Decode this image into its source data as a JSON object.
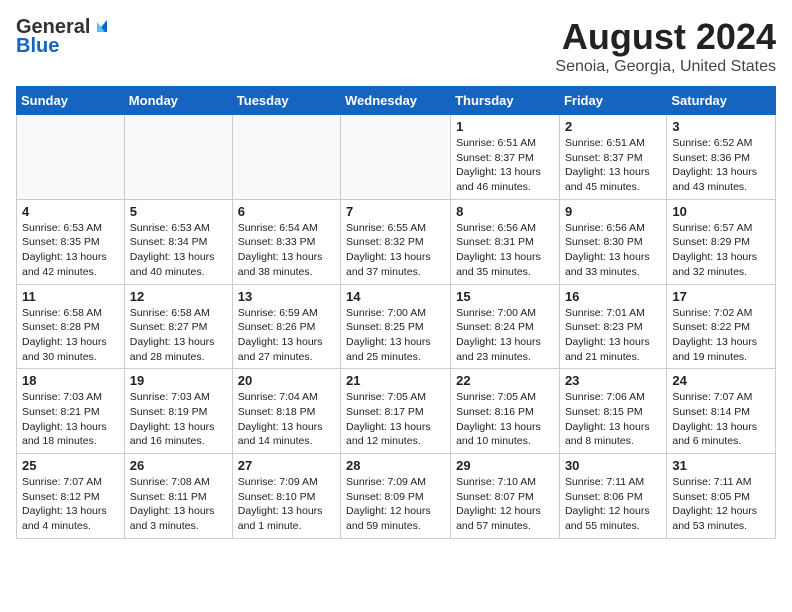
{
  "header": {
    "logo_general": "General",
    "logo_blue": "Blue",
    "title": "August 2024",
    "subtitle": "Senoia, Georgia, United States"
  },
  "days_of_week": [
    "Sunday",
    "Monday",
    "Tuesday",
    "Wednesday",
    "Thursday",
    "Friday",
    "Saturday"
  ],
  "weeks": [
    [
      {
        "day": "",
        "content": ""
      },
      {
        "day": "",
        "content": ""
      },
      {
        "day": "",
        "content": ""
      },
      {
        "day": "",
        "content": ""
      },
      {
        "day": "1",
        "content": "Sunrise: 6:51 AM\nSunset: 8:37 PM\nDaylight: 13 hours\nand 46 minutes."
      },
      {
        "day": "2",
        "content": "Sunrise: 6:51 AM\nSunset: 8:37 PM\nDaylight: 13 hours\nand 45 minutes."
      },
      {
        "day": "3",
        "content": "Sunrise: 6:52 AM\nSunset: 8:36 PM\nDaylight: 13 hours\nand 43 minutes."
      }
    ],
    [
      {
        "day": "4",
        "content": "Sunrise: 6:53 AM\nSunset: 8:35 PM\nDaylight: 13 hours\nand 42 minutes."
      },
      {
        "day": "5",
        "content": "Sunrise: 6:53 AM\nSunset: 8:34 PM\nDaylight: 13 hours\nand 40 minutes."
      },
      {
        "day": "6",
        "content": "Sunrise: 6:54 AM\nSunset: 8:33 PM\nDaylight: 13 hours\nand 38 minutes."
      },
      {
        "day": "7",
        "content": "Sunrise: 6:55 AM\nSunset: 8:32 PM\nDaylight: 13 hours\nand 37 minutes."
      },
      {
        "day": "8",
        "content": "Sunrise: 6:56 AM\nSunset: 8:31 PM\nDaylight: 13 hours\nand 35 minutes."
      },
      {
        "day": "9",
        "content": "Sunrise: 6:56 AM\nSunset: 8:30 PM\nDaylight: 13 hours\nand 33 minutes."
      },
      {
        "day": "10",
        "content": "Sunrise: 6:57 AM\nSunset: 8:29 PM\nDaylight: 13 hours\nand 32 minutes."
      }
    ],
    [
      {
        "day": "11",
        "content": "Sunrise: 6:58 AM\nSunset: 8:28 PM\nDaylight: 13 hours\nand 30 minutes."
      },
      {
        "day": "12",
        "content": "Sunrise: 6:58 AM\nSunset: 8:27 PM\nDaylight: 13 hours\nand 28 minutes."
      },
      {
        "day": "13",
        "content": "Sunrise: 6:59 AM\nSunset: 8:26 PM\nDaylight: 13 hours\nand 27 minutes."
      },
      {
        "day": "14",
        "content": "Sunrise: 7:00 AM\nSunset: 8:25 PM\nDaylight: 13 hours\nand 25 minutes."
      },
      {
        "day": "15",
        "content": "Sunrise: 7:00 AM\nSunset: 8:24 PM\nDaylight: 13 hours\nand 23 minutes."
      },
      {
        "day": "16",
        "content": "Sunrise: 7:01 AM\nSunset: 8:23 PM\nDaylight: 13 hours\nand 21 minutes."
      },
      {
        "day": "17",
        "content": "Sunrise: 7:02 AM\nSunset: 8:22 PM\nDaylight: 13 hours\nand 19 minutes."
      }
    ],
    [
      {
        "day": "18",
        "content": "Sunrise: 7:03 AM\nSunset: 8:21 PM\nDaylight: 13 hours\nand 18 minutes."
      },
      {
        "day": "19",
        "content": "Sunrise: 7:03 AM\nSunset: 8:19 PM\nDaylight: 13 hours\nand 16 minutes."
      },
      {
        "day": "20",
        "content": "Sunrise: 7:04 AM\nSunset: 8:18 PM\nDaylight: 13 hours\nand 14 minutes."
      },
      {
        "day": "21",
        "content": "Sunrise: 7:05 AM\nSunset: 8:17 PM\nDaylight: 13 hours\nand 12 minutes."
      },
      {
        "day": "22",
        "content": "Sunrise: 7:05 AM\nSunset: 8:16 PM\nDaylight: 13 hours\nand 10 minutes."
      },
      {
        "day": "23",
        "content": "Sunrise: 7:06 AM\nSunset: 8:15 PM\nDaylight: 13 hours\nand 8 minutes."
      },
      {
        "day": "24",
        "content": "Sunrise: 7:07 AM\nSunset: 8:14 PM\nDaylight: 13 hours\nand 6 minutes."
      }
    ],
    [
      {
        "day": "25",
        "content": "Sunrise: 7:07 AM\nSunset: 8:12 PM\nDaylight: 13 hours\nand 4 minutes."
      },
      {
        "day": "26",
        "content": "Sunrise: 7:08 AM\nSunset: 8:11 PM\nDaylight: 13 hours\nand 3 minutes."
      },
      {
        "day": "27",
        "content": "Sunrise: 7:09 AM\nSunset: 8:10 PM\nDaylight: 13 hours\nand 1 minute."
      },
      {
        "day": "28",
        "content": "Sunrise: 7:09 AM\nSunset: 8:09 PM\nDaylight: 12 hours\nand 59 minutes."
      },
      {
        "day": "29",
        "content": "Sunrise: 7:10 AM\nSunset: 8:07 PM\nDaylight: 12 hours\nand 57 minutes."
      },
      {
        "day": "30",
        "content": "Sunrise: 7:11 AM\nSunset: 8:06 PM\nDaylight: 12 hours\nand 55 minutes."
      },
      {
        "day": "31",
        "content": "Sunrise: 7:11 AM\nSunset: 8:05 PM\nDaylight: 12 hours\nand 53 minutes."
      }
    ]
  ]
}
